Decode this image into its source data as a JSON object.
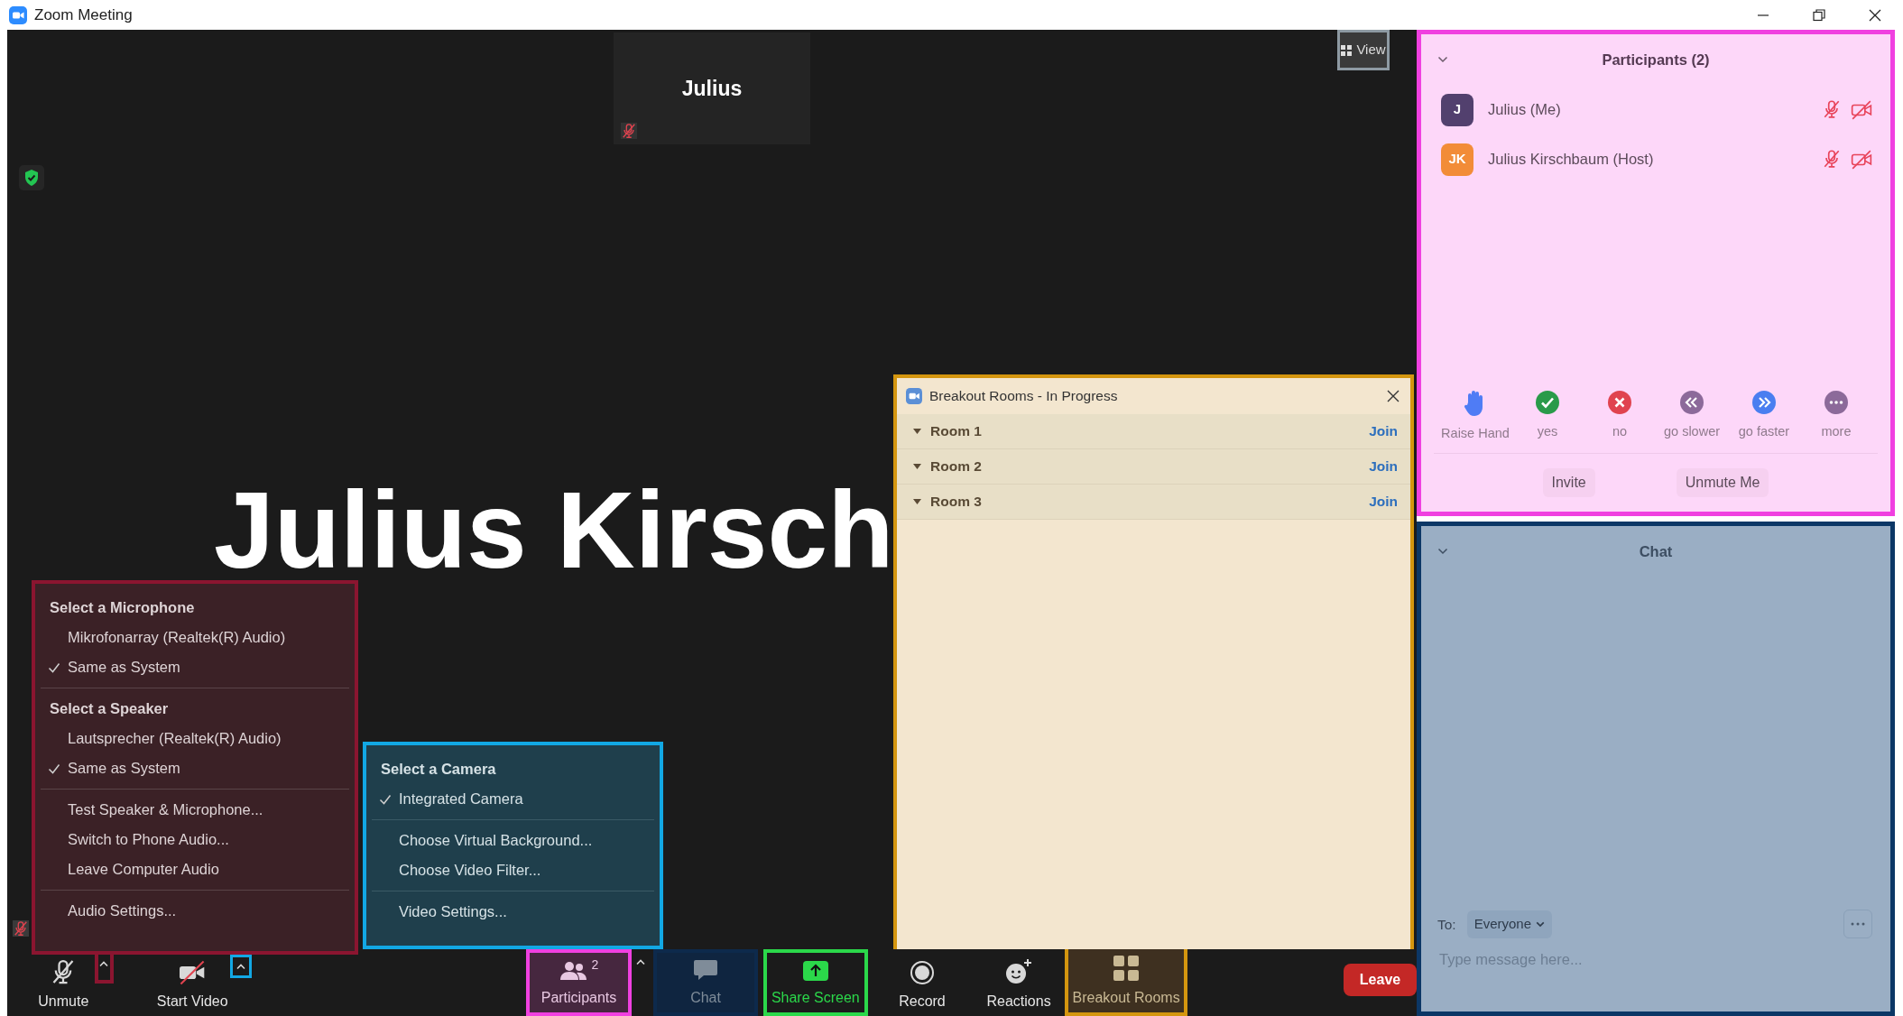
{
  "window": {
    "title": "Zoom Meeting"
  },
  "stage": {
    "tile_name": "Julius",
    "view_button": "View",
    "speaker_name": "Julius Kirsch"
  },
  "audio_menu": {
    "sections": [
      {
        "heading": "Select a Microphone",
        "items": [
          {
            "label": "Mikrofonarray (Realtek(R) Audio)",
            "checked": false
          },
          {
            "label": "Same as System",
            "checked": true
          }
        ]
      },
      {
        "heading": "Select a Speaker",
        "items": [
          {
            "label": "Lautsprecher (Realtek(R) Audio)",
            "checked": false
          },
          {
            "label": "Same as System",
            "checked": true
          }
        ]
      },
      {
        "items": [
          {
            "label": "Test Speaker & Microphone..."
          },
          {
            "label": "Switch to Phone Audio..."
          },
          {
            "label": "Leave Computer Audio"
          }
        ]
      },
      {
        "items": [
          {
            "label": "Audio Settings..."
          }
        ]
      }
    ]
  },
  "camera_menu": {
    "sections": [
      {
        "heading": "Select a Camera",
        "items": [
          {
            "label": "Integrated Camera",
            "checked": true
          }
        ]
      },
      {
        "items": [
          {
            "label": "Choose Virtual Background..."
          },
          {
            "label": "Choose Video Filter..."
          }
        ]
      },
      {
        "items": [
          {
            "label": "Video Settings..."
          }
        ]
      }
    ]
  },
  "breakout": {
    "title": "Breakout Rooms - In Progress",
    "rooms": [
      {
        "name": "Room 1",
        "action": "Join"
      },
      {
        "name": "Room 2",
        "action": "Join"
      },
      {
        "name": "Room 3",
        "action": "Join"
      }
    ]
  },
  "toolbar": [
    {
      "kind": "unmute",
      "label": "Unmute"
    },
    {
      "kind": "audio-caret"
    },
    {
      "kind": "video",
      "label": "Start Video"
    },
    {
      "kind": "video-caret"
    },
    {
      "kind": "participants",
      "label": "Participants",
      "count": "2"
    },
    {
      "kind": "participants-caret"
    },
    {
      "kind": "chat",
      "label": "Chat"
    },
    {
      "kind": "share",
      "label": "Share Screen"
    },
    {
      "kind": "record",
      "label": "Record"
    },
    {
      "kind": "reactions",
      "label": "Reactions"
    },
    {
      "kind": "breakout",
      "label": "Breakout Rooms"
    },
    {
      "kind": "leave",
      "label": "Leave"
    }
  ],
  "participants_panel": {
    "title": "Participants (2)",
    "people": [
      {
        "initials": "J",
        "name": "Julius (Me)",
        "color": "#52406e"
      },
      {
        "initials": "JK",
        "name": "Julius Kirschbaum (Host)",
        "color": "#f28c38"
      }
    ],
    "reactions": [
      {
        "kind": "raise-hand",
        "label": "Raise Hand",
        "color": "#4f7cf5"
      },
      {
        "kind": "yes",
        "label": "yes",
        "color": "#2a9a4a"
      },
      {
        "kind": "no",
        "label": "no",
        "color": "#e0434f"
      },
      {
        "kind": "slower",
        "label": "go slower",
        "color": "#8c6a9a"
      },
      {
        "kind": "faster",
        "label": "go faster",
        "color": "#4a7ef0"
      },
      {
        "kind": "more",
        "label": "more",
        "color": "#8c6a9a"
      }
    ],
    "buttons": [
      "Invite",
      "Unmute Me"
    ]
  },
  "chat": {
    "title": "Chat",
    "to_label": "To:",
    "recipient": "Everyone",
    "placeholder": "Type message here..."
  }
}
